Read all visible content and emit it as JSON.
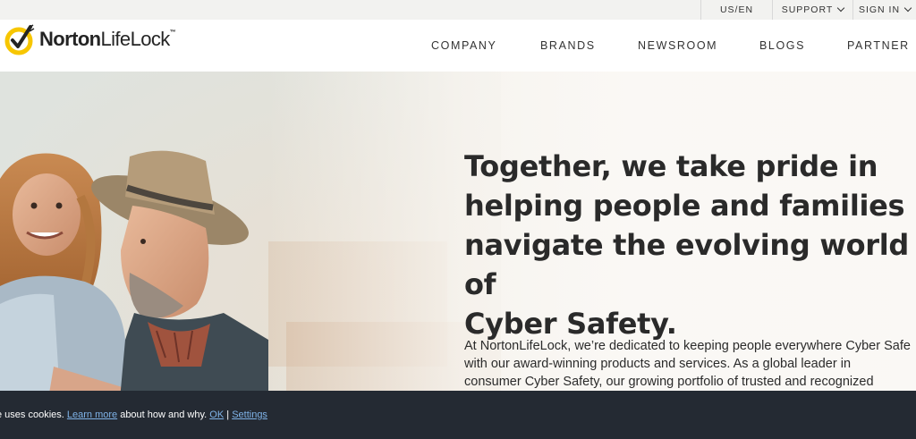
{
  "utility": {
    "locale": "US/EN",
    "support": "SUPPORT",
    "signin": "SIGN IN"
  },
  "brand": {
    "name_bold": "Norton",
    "name_light": "LifeLock",
    "tm": "™",
    "logo_colors": {
      "ring": "#f7c600",
      "check": "#242424"
    }
  },
  "nav": {
    "company": "COMPANY",
    "brands": "BRANDS",
    "newsroom": "NEWSROOM",
    "blogs": "BLOGS",
    "partner": "PARTNER"
  },
  "hero": {
    "headline_lines": [
      "Together, we take pride in",
      "helping people and families",
      "navigate the evolving world of",
      "Cyber Safety."
    ],
    "body_lines": [
      "At NortonLifeLock, we’re dedicated to keeping people everywhere Cyber Safe",
      "with our award-winning products and services. As a global leader in",
      "consumer Cyber Safety, our growing portfolio of trusted and recognized"
    ]
  },
  "cookie": {
    "prefix": "e uses cookies. ",
    "learn_more": "Learn more",
    "middle": " about how and why. ",
    "ok": "OK",
    "separator": " | ",
    "settings": "Settings"
  },
  "icons": {
    "logo": "norton-check-icon",
    "dropdown": "chevron-down-icon"
  }
}
